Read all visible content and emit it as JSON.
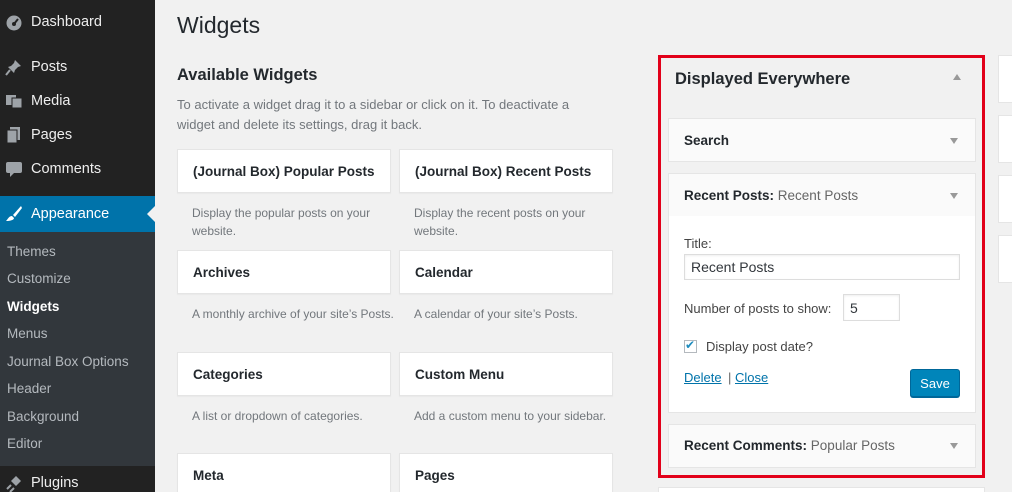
{
  "sidebar": {
    "menu": [
      {
        "label": "Dashboard",
        "icon": "dashboard-icon"
      },
      {
        "label": "Posts",
        "icon": "pin-icon"
      },
      {
        "label": "Media",
        "icon": "media-icon"
      },
      {
        "label": "Pages",
        "icon": "pages-icon"
      },
      {
        "label": "Comments",
        "icon": "comment-icon"
      },
      {
        "label": "Appearance",
        "icon": "brush-icon"
      },
      {
        "label": "Plugins",
        "icon": "plugin-icon"
      }
    ],
    "submenu": [
      "Themes",
      "Customize",
      "Widgets",
      "Menus",
      "Journal Box Options",
      "Header",
      "Background",
      "Editor"
    ]
  },
  "main": {
    "title": "Widgets",
    "available_title": "Available Widgets",
    "available_desc": "To activate a widget drag it to a sidebar or click on it. To deactivate a widget and delete its settings, drag it back.",
    "widgets": [
      {
        "name": "(Journal Box) Popular Posts",
        "desc": "Display the popular posts on your website."
      },
      {
        "name": "(Journal Box) Recent Posts",
        "desc": "Display the recent posts on your website."
      },
      {
        "name": "Archives",
        "desc": "A monthly archive of your site’s Posts."
      },
      {
        "name": "Calendar",
        "desc": "A calendar of your site’s Posts."
      },
      {
        "name": "Categories",
        "desc": "A list or dropdown of categories."
      },
      {
        "name": "Custom Menu",
        "desc": "Add a custom menu to your sidebar."
      },
      {
        "name": "Meta",
        "desc": ""
      },
      {
        "name": "Pages",
        "desc": ""
      }
    ]
  },
  "panel": {
    "title": "Displayed Everywhere",
    "search_widget": "Search",
    "recent_posts_widget": {
      "name": "Recent Posts:",
      "instance": "Recent Posts"
    },
    "form": {
      "title_label": "Title:",
      "title_value": "Recent Posts",
      "count_label": "Number of posts to show:",
      "count_value": "5",
      "show_date_label": "Display post date?",
      "show_date_checked": true,
      "delete_label": "Delete",
      "separator": "|",
      "close_label": "Close",
      "save_label": "Save"
    },
    "recent_comments_widget": {
      "name": "Recent Comments:",
      "instance": "Popular Posts"
    }
  },
  "colors": {
    "sidebar_bg": "#222222",
    "current_menu_bg": "#0073aa",
    "highlight_outline": "#e2001a",
    "save_button": "#0085ba"
  }
}
